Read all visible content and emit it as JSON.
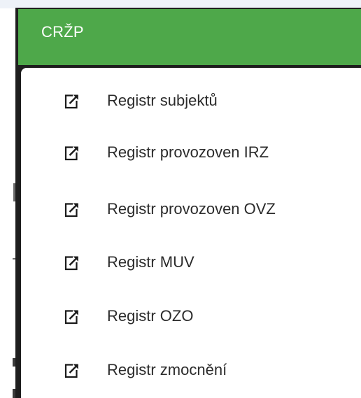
{
  "header": {
    "title": "CRŽP",
    "color": "#4ea84a"
  },
  "menu": {
    "icon": "external-link-icon",
    "items": [
      {
        "label": "Registr subjektů"
      },
      {
        "label": "Registr provozoven IRZ"
      },
      {
        "label": "Registr provozoven OVZ"
      },
      {
        "label": "Registr MUV"
      },
      {
        "label": "Registr OZO"
      },
      {
        "label": "Registr zmocnění"
      }
    ]
  }
}
